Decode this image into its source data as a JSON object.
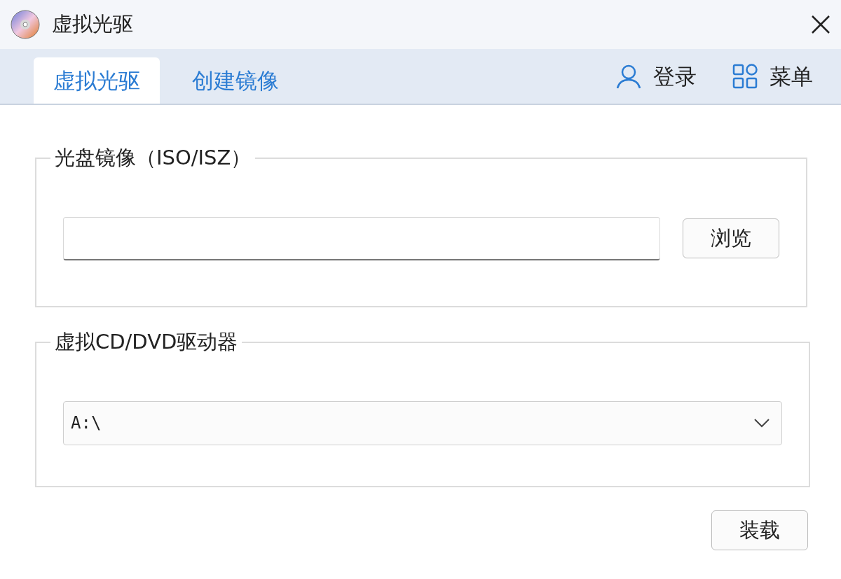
{
  "window": {
    "title": "虚拟光驱"
  },
  "tabs": [
    {
      "label": "虚拟光驱",
      "selected": true
    },
    {
      "label": "创建镜像",
      "selected": false
    }
  ],
  "header_actions": [
    {
      "kind": "user",
      "label": "登录"
    },
    {
      "kind": "menu",
      "label": "菜单"
    }
  ],
  "image_group": {
    "title": "光盘镜像（ISO/ISZ）",
    "browse_button": "浏览"
  },
  "drive_group": {
    "title": "虚拟CD/DVD驱动器",
    "drive_select": {
      "value": "A:\\"
    }
  },
  "mount_button": "装载"
}
